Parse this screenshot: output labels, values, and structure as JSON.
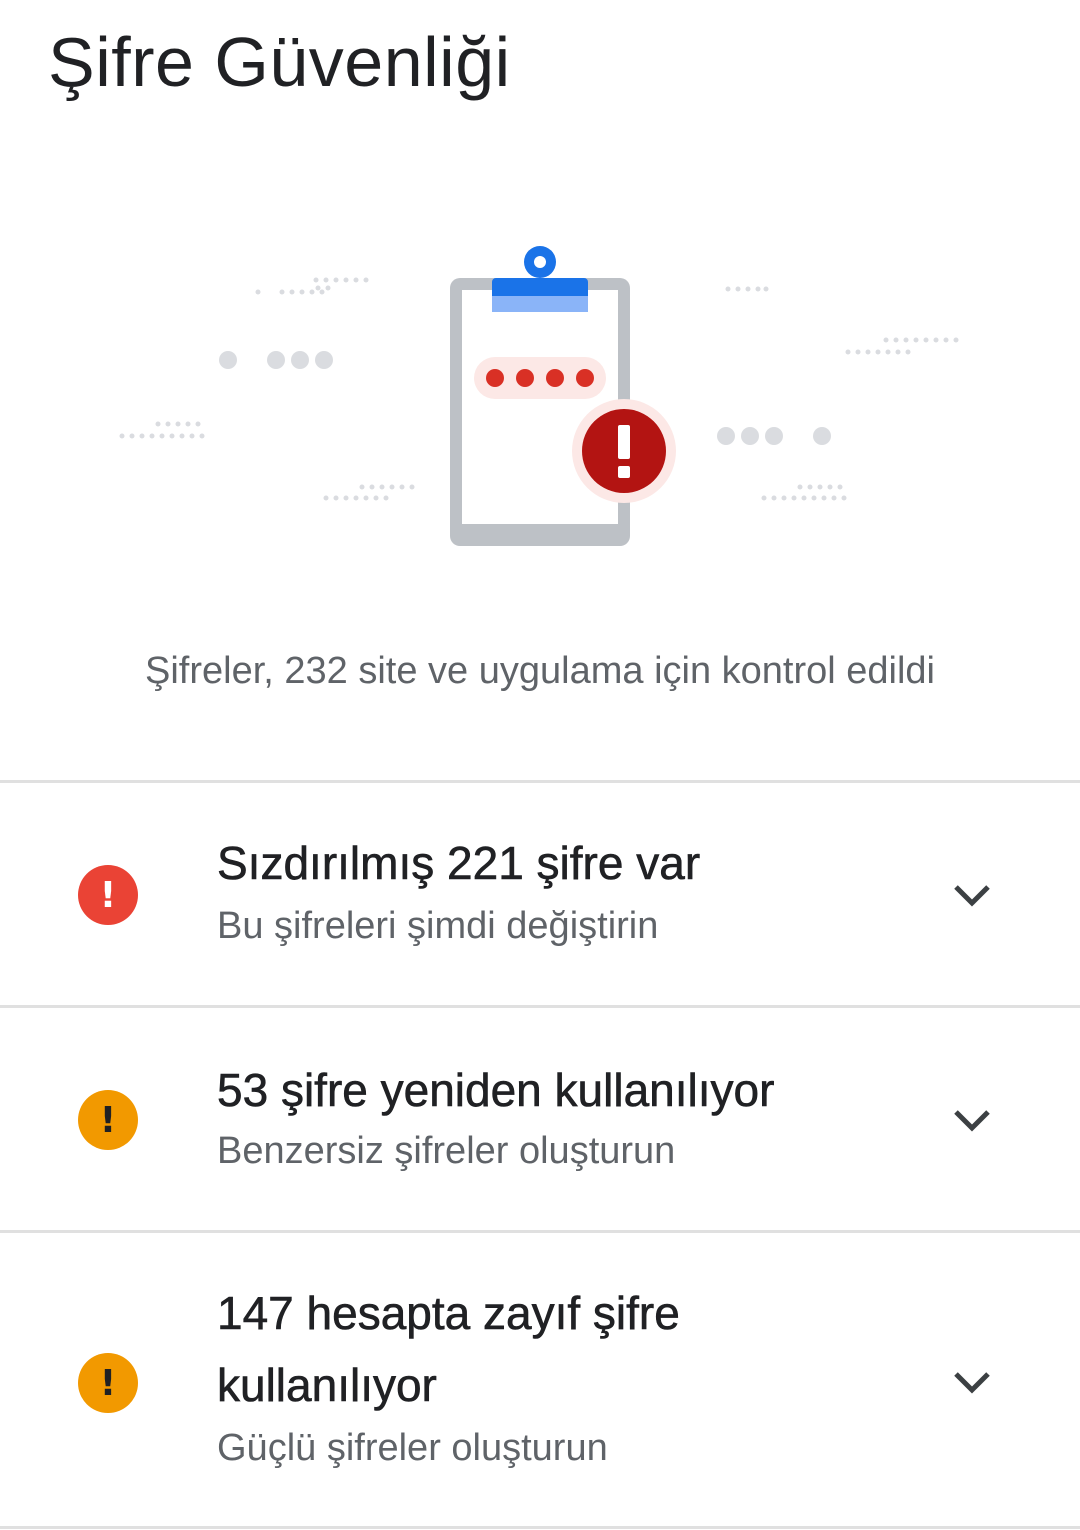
{
  "header": {
    "title": "Şifre Güvenliği"
  },
  "illustration": {
    "icon": "clipboard-password-warning-icon",
    "alert_glyph": "!",
    "colors": {
      "clip": "#1a73e8",
      "board_frame": "#bdc1c6",
      "password_dots": "#d93025",
      "password_pill": "#fce8e6",
      "alert_badge": "#b31412"
    }
  },
  "summary": {
    "text": "Şifreler, 232 site ve uygulama için kontrol edildi"
  },
  "issues": [
    {
      "icon": "error-icon",
      "glyph": "!",
      "severity_color": "#ea4335",
      "title": "Sızdırılmış 221 şifre var",
      "subtitle": "Bu şifreleri şimdi değiştirin"
    },
    {
      "icon": "warning-icon",
      "glyph": "!",
      "severity_color": "#f29900",
      "title": "53 şifre yeniden kullanılıyor",
      "subtitle": "Benzersiz şifreler oluşturun"
    },
    {
      "icon": "warning-icon",
      "glyph": "!",
      "severity_color": "#f29900",
      "title": "147 hesapta zayıf şifre kullanılıyor",
      "subtitle": "Güçlü şifreler oluşturun"
    }
  ]
}
